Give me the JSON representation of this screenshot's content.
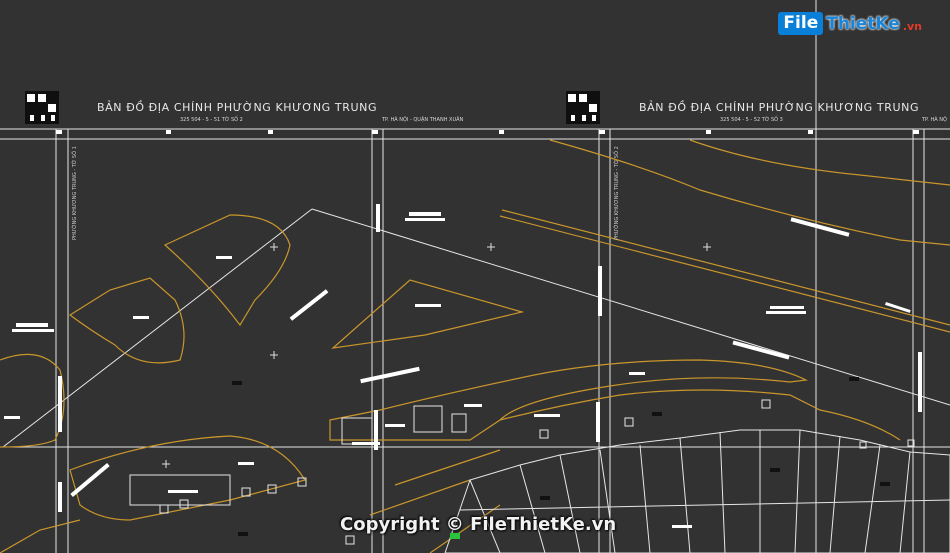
{
  "logo": {
    "part1": "File",
    "part2": "ThietKe",
    "suffix": ".vn"
  },
  "sheets": [
    {
      "title": "BẢN ĐỒ ĐỊA CHÍNH PHƯỜNG KHƯƠNG TRUNG",
      "code": "325 504 - 5 - 51 TỜ SỐ 2",
      "side_label": "TP. HÀ NỘI - QUẬN THANH XUÂN",
      "vertical_label": "PHƯỜNG KHƯƠNG TRUNG - TỜ SỐ 1"
    },
    {
      "title": "BẢN ĐỒ ĐỊA CHÍNH PHƯỜNG KHƯƠNG TRUNG",
      "code": "325 504 - 5 - 52 TỜ SỐ 3",
      "side_label": "TP. HÀ NỘ",
      "vertical_label": "PHƯỜNG KHƯƠNG TRUNG - TỜ SỐ 2"
    }
  ],
  "watermark": "Copyright © FileThietKe.vn",
  "colors": {
    "background": "#323232",
    "frame": "#e6e6e6",
    "parcel_outline": "#c9962b",
    "labels": "#ffffff"
  }
}
